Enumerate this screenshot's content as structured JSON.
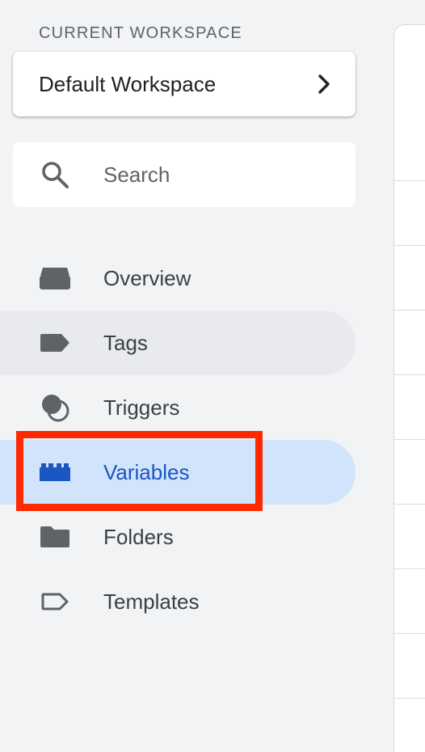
{
  "workspace": {
    "section_label": "CURRENT WORKSPACE",
    "name": "Default Workspace"
  },
  "search": {
    "placeholder": "Search",
    "value": ""
  },
  "nav": {
    "items": [
      {
        "label": "Overview",
        "icon": "overview-icon"
      },
      {
        "label": "Tags",
        "icon": "tag-icon"
      },
      {
        "label": "Triggers",
        "icon": "trigger-icon"
      },
      {
        "label": "Variables",
        "icon": "variables-icon"
      },
      {
        "label": "Folders",
        "icon": "folder-icon"
      },
      {
        "label": "Templates",
        "icon": "template-icon"
      }
    ],
    "active": "Variables",
    "hovered": "Tags"
  },
  "colors": {
    "sidebar_bg": "#f1f3f4",
    "active_bg": "#d2e3fc",
    "active_text": "#1a56c4",
    "hover_bg": "#e8eaed",
    "icon_gray": "#5f6368",
    "highlight_red": "#ff2a00"
  }
}
